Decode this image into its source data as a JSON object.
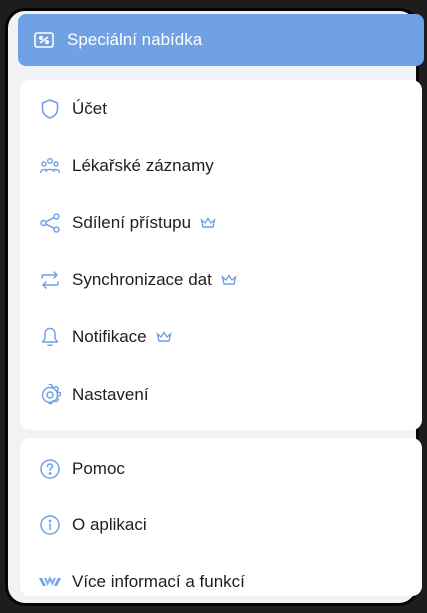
{
  "colors": {
    "accent": "#6fa1e4",
    "icon": "#6fa1e4",
    "text": "#1e1e1e",
    "card": "#ffffff",
    "background": "#f1f2f5"
  },
  "promo": {
    "label": "Speciální nabídka",
    "icon": "ticket-icon"
  },
  "menu_main": [
    {
      "label": "Účet",
      "icon": "shield-icon",
      "premium": false
    },
    {
      "label": "Lékařské záznamy",
      "icon": "users-group-icon",
      "premium": false
    },
    {
      "label": "Sdílení přístupu",
      "icon": "share-icon",
      "premium": true
    },
    {
      "label": "Synchronizace dat",
      "icon": "sync-icon",
      "premium": true
    },
    {
      "label": "Notifikace",
      "icon": "bell-icon",
      "premium": true
    },
    {
      "label": "Nastavení",
      "icon": "gear-icon",
      "premium": false
    }
  ],
  "menu_secondary": [
    {
      "label": "Pomoc",
      "icon": "help-icon"
    },
    {
      "label": "O aplikaci",
      "icon": "info-icon"
    },
    {
      "label": "Více informací a funkcí",
      "icon": "app-logo-icon"
    }
  ]
}
